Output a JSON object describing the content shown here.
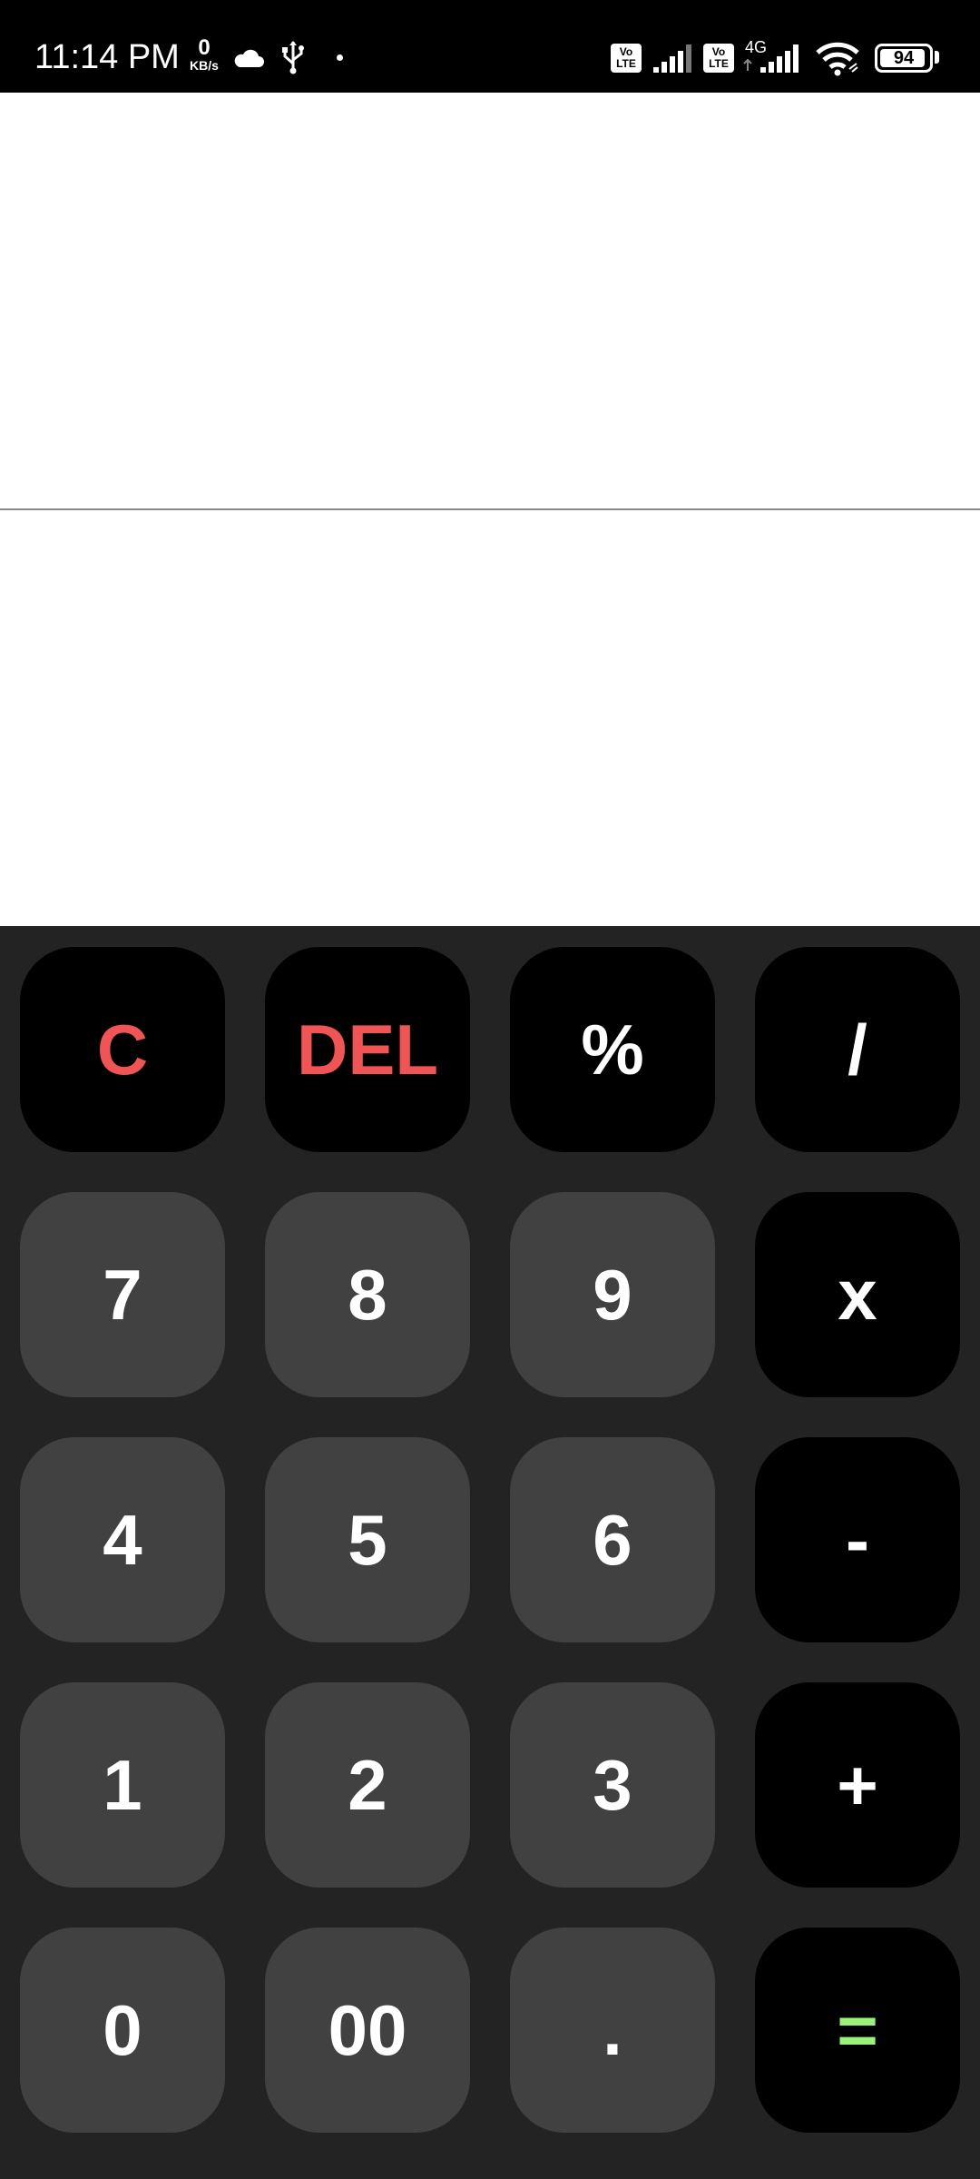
{
  "status_bar": {
    "time": "11:14 PM",
    "net_speed_value": "0",
    "net_speed_unit": "KB/s",
    "volte_1": "Vo LTE",
    "volte_2": "Vo LTE",
    "network_type": "4G",
    "battery_level": "94",
    "icons": [
      "cloud-icon",
      "usb-icon",
      "notification-dot-icon",
      "signal-icon",
      "signal-icon",
      "wifi-icon",
      "battery-icon"
    ]
  },
  "display": {
    "expression": "",
    "result": ""
  },
  "keypad": {
    "rows": [
      [
        "C",
        "DEL",
        "%",
        "/"
      ],
      [
        "7",
        "8",
        "9",
        "x"
      ],
      [
        "4",
        "5",
        "6",
        "-"
      ],
      [
        "1",
        "2",
        "3",
        "+"
      ],
      [
        "0",
        "00",
        ".",
        "="
      ]
    ]
  },
  "colors": {
    "keypad_background": "#232323",
    "number_key": "#414141",
    "operator_key": "#000000",
    "clear_text": "#f05454",
    "equals_text": "#9bf27a"
  }
}
